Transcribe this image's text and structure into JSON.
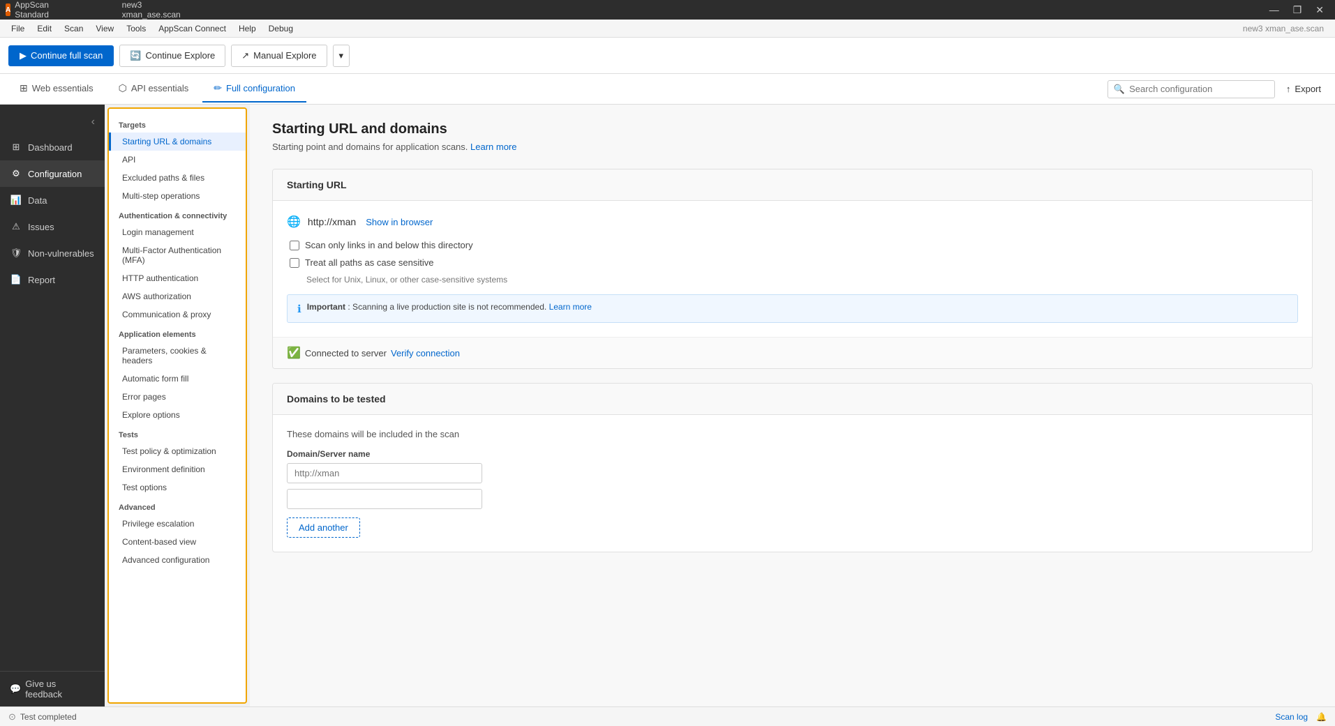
{
  "window": {
    "title": "new3 xman_ase.scan",
    "logo": "A"
  },
  "titlebar": {
    "minimize": "—",
    "maximize": "❐",
    "close": "✕"
  },
  "menubar": {
    "items": [
      "File",
      "Edit",
      "Scan",
      "View",
      "Tools",
      "AppScan Connect",
      "Help",
      "Debug"
    ],
    "window_title": "new3 xman_ase.scan"
  },
  "toolbar": {
    "continue_full_scan": "Continue full scan",
    "continue_explore": "Continue Explore",
    "manual_explore": "Manual Explore"
  },
  "tabs": {
    "web_essentials": "Web essentials",
    "api_essentials": "API essentials",
    "full_configuration": "Full configuration",
    "search_placeholder": "Search configuration",
    "export": "Export"
  },
  "config_sidebar": {
    "targets_section": "Targets",
    "items_targets": [
      {
        "id": "starting-url",
        "label": "Starting URL & domains",
        "active": true
      },
      {
        "id": "api",
        "label": "API",
        "active": false
      },
      {
        "id": "excluded-paths",
        "label": "Excluded paths & files",
        "active": false
      },
      {
        "id": "multi-step",
        "label": "Multi-step operations",
        "active": false
      }
    ],
    "auth_section": "Authentication & connectivity",
    "items_auth": [
      {
        "id": "login-mgmt",
        "label": "Login management",
        "active": false
      },
      {
        "id": "mfa",
        "label": "Multi-Factor Authentication (MFA)",
        "active": false
      },
      {
        "id": "http-auth",
        "label": "HTTP authentication",
        "active": false
      },
      {
        "id": "aws-auth",
        "label": "AWS authorization",
        "active": false
      },
      {
        "id": "comm-proxy",
        "label": "Communication & proxy",
        "active": false
      }
    ],
    "app_elements_section": "Application elements",
    "items_app": [
      {
        "id": "params-cookies",
        "label": "Parameters, cookies & headers",
        "active": false
      },
      {
        "id": "auto-form",
        "label": "Automatic form fill",
        "active": false
      },
      {
        "id": "error-pages",
        "label": "Error pages",
        "active": false
      },
      {
        "id": "explore-options",
        "label": "Explore options",
        "active": false
      }
    ],
    "tests_section": "Tests",
    "items_tests": [
      {
        "id": "test-policy",
        "label": "Test policy & optimization",
        "active": false
      },
      {
        "id": "env-def",
        "label": "Environment definition",
        "active": false
      },
      {
        "id": "test-options",
        "label": "Test options",
        "active": false
      }
    ],
    "advanced_section": "Advanced",
    "items_advanced": [
      {
        "id": "privilege",
        "label": "Privilege escalation",
        "active": false
      },
      {
        "id": "content-view",
        "label": "Content-based view",
        "active": false
      },
      {
        "id": "adv-config",
        "label": "Advanced configuration",
        "active": false
      }
    ]
  },
  "app_nav": {
    "items": [
      {
        "id": "dashboard",
        "label": "Dashboard",
        "icon": "⊞"
      },
      {
        "id": "configuration",
        "label": "Configuration",
        "icon": "⚙",
        "active": true
      },
      {
        "id": "data",
        "label": "Data",
        "icon": "📊"
      },
      {
        "id": "issues",
        "label": "Issues",
        "icon": "⚠"
      },
      {
        "id": "non-vulns",
        "label": "Non-vulnerables",
        "icon": "🛡"
      },
      {
        "id": "report",
        "label": "Report",
        "icon": "📄"
      }
    ],
    "feedback": "Give us feedback",
    "test_completed": "Test completed"
  },
  "main_content": {
    "title": "Starting URL and domains",
    "subtitle": "Starting point and domains for application scans.",
    "learn_more": "Learn more",
    "starting_url_card": {
      "header": "Starting URL",
      "url": "http://xman",
      "show_in_browser": "Show in browser",
      "checkbox1_label": "Scan only links in and below this directory",
      "checkbox2_label": "Treat all paths as case sensitive",
      "checkbox2_sublabel": "Select for Unix, Linux, or other case-sensitive systems",
      "important_label": "Important",
      "important_text": ": Scanning a live production site is not recommended.",
      "learn_more": "Learn more",
      "connected_text": "Connected to server",
      "verify_link": "Verify connection"
    },
    "domains_card": {
      "header": "Domains to be tested",
      "description": "These domains will be included in the scan",
      "field_label": "Domain/Server name",
      "placeholder": "http://xman",
      "input2_value": "",
      "add_another": "Add another"
    }
  },
  "statusbar": {
    "test_completed": "Test completed",
    "scan_log": "Scan log",
    "bell_icon": "🔔"
  }
}
